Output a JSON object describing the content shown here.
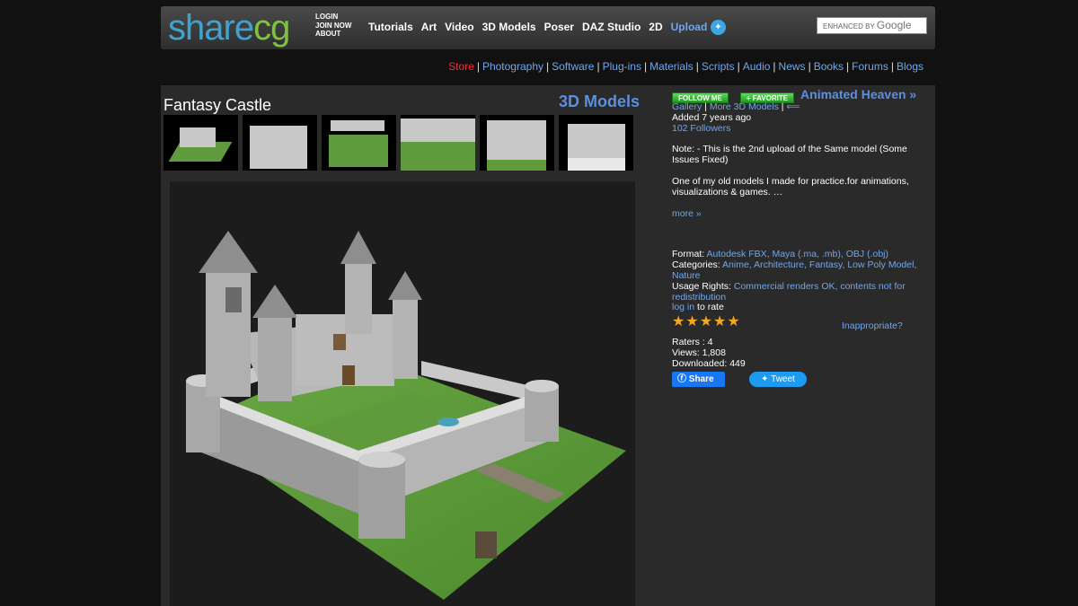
{
  "header": {
    "logo_part1": "share",
    "logo_part2": "cg",
    "account_links": [
      "LOGIN",
      "JOIN NOW",
      "ABOUT"
    ],
    "nav": [
      "Tutorials",
      "Art",
      "Video",
      "3D Models",
      "Poser",
      "DAZ Studio",
      "2D",
      "Upload"
    ],
    "search_prefix": "ENHANCED BY",
    "search_brand": "Google"
  },
  "subnav": {
    "store": "Store",
    "links": [
      "Photography",
      "Software",
      "Plug-ins",
      "Materials",
      "Scripts",
      "Audio",
      "News",
      "Books",
      "Forums",
      "Blogs"
    ],
    "separator": "|"
  },
  "item": {
    "title": "Fantasy Castle",
    "category": "3D Models"
  },
  "side": {
    "follow_label": "FOLLOW ME",
    "favorite_label": "+ FAVORITE",
    "author": "Animated Heaven »",
    "gallery": "Gallery",
    "more_models": "More 3D Models",
    "added": "Added 7 years ago",
    "followers": "102 Followers",
    "note": "Note: - This is the 2nd upload of the Same model (Some Issues Fixed)",
    "description": "One of my old models I made for practice.for animations, visualizations & games. …",
    "more": "more »",
    "format_label": "Format:",
    "formats": "Autodesk FBX, Maya (.ma, .mb), OBJ (.obj)",
    "categories_label": "Categories:",
    "categories": "Anime, Architecture, Fantasy, Low Poly Model, Nature",
    "usage_label": "Usage Rights:",
    "usage": "Commercial renders OK, contents not for redistribution",
    "login_link": "log in",
    "to_rate": "to rate",
    "inappropriate": "Inappropriate?",
    "rating": 5,
    "raters": "Raters : 4",
    "views": "Views: 1,808",
    "downloaded": "Downloaded: 449",
    "share_label": "Share",
    "tweet_label": "Tweet"
  },
  "colors": {
    "link": "#6fa7ee",
    "accent_blue": "#5b8fe0",
    "store_red": "#ee3333",
    "follow_green": "#2fb32f"
  }
}
